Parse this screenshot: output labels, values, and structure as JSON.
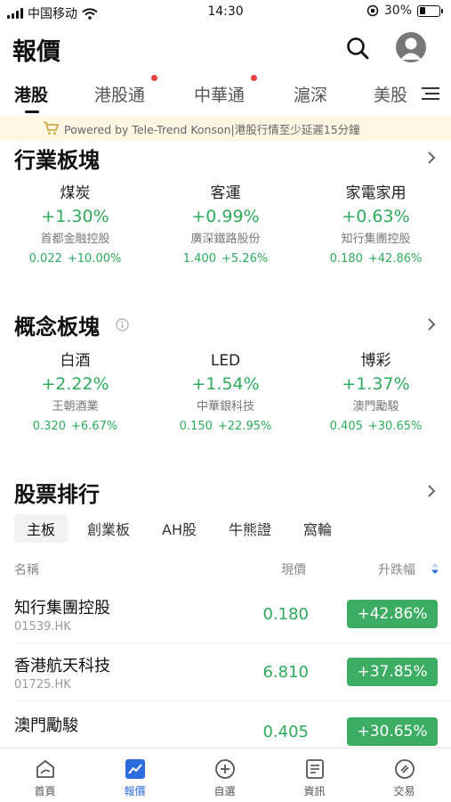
{
  "status_bar": {
    "carrier": "中国移动",
    "time": "14:30",
    "battery": "30%",
    "battery_level": 0.3
  },
  "header": {
    "title": "報價",
    "icons": [
      "search-icon",
      "avatar-icon"
    ]
  },
  "tabs": [
    {
      "label": "港股",
      "active": true,
      "dot": false
    },
    {
      "label": "港股通",
      "active": false,
      "dot": true
    },
    {
      "label": "中華通",
      "active": false,
      "dot": true
    },
    {
      "label": "滬深",
      "active": false,
      "dot": false
    },
    {
      "label": "美股",
      "active": false,
      "dot": false
    }
  ],
  "banner": {
    "text": "Powered by Tele-Trend Konson|港股行情至少延遲15分鐘"
  },
  "industry": {
    "title": "行業板塊",
    "items": [
      {
        "name": "煤炭",
        "change": "+1.30%",
        "leader": "首都金融控股",
        "price": "0.022",
        "leader_change": "+10.00%"
      },
      {
        "name": "客運",
        "change": "+0.99%",
        "leader": "廣深鐵路股份",
        "price": "1.400",
        "leader_change": "+5.26%"
      },
      {
        "name": "家電家用",
        "change": "+0.63%",
        "leader": "知行集團控股",
        "price": "0.180",
        "leader_change": "+42.86%"
      }
    ]
  },
  "concept": {
    "title": "概念板塊",
    "items": [
      {
        "name": "白酒",
        "change": "+2.22%",
        "leader": "王朝酒業",
        "price": "0.320",
        "leader_change": "+6.67%"
      },
      {
        "name": "LED",
        "change": "+1.54%",
        "leader": "中華銀科技",
        "price": "0.150",
        "leader_change": "+22.95%"
      },
      {
        "name": "博彩",
        "change": "+1.37%",
        "leader": "澳門勵駿",
        "price": "0.405",
        "leader_change": "+30.65%"
      }
    ]
  },
  "ranking": {
    "title": "股票排行",
    "boards": [
      {
        "label": "主板",
        "active": true
      },
      {
        "label": "創業板",
        "active": false
      },
      {
        "label": "AH股",
        "active": false
      },
      {
        "label": "牛熊證",
        "active": false
      },
      {
        "label": "窩輪",
        "active": false
      }
    ],
    "columns": {
      "name": "名稱",
      "price": "現價",
      "change": "升跌幅"
    },
    "rows": [
      {
        "name": "知行集團控股",
        "code": "01539.HK",
        "price": "0.180",
        "change": "+42.86%"
      },
      {
        "name": "香港航天科技",
        "code": "01725.HK",
        "price": "6.810",
        "change": "+37.85%"
      },
      {
        "name": "澳門勵駿",
        "code": "",
        "price": "0.405",
        "change": "+30.65%"
      }
    ]
  },
  "bottom_nav": [
    {
      "label": "首頁",
      "icon": "home-icon",
      "active": false
    },
    {
      "label": "報價",
      "icon": "chart-icon",
      "active": true
    },
    {
      "label": "自選",
      "icon": "add-circle-icon",
      "active": false
    },
    {
      "label": "資訊",
      "icon": "news-icon",
      "active": false
    },
    {
      "label": "交易",
      "icon": "trade-icon",
      "active": false
    }
  ],
  "colors": {
    "up": "#2eaa5c",
    "badge": "#3dad63",
    "active_nav": "#2d6cdf",
    "tab_dot": "#e04040",
    "banner_bg": "#fdf6e3"
  }
}
